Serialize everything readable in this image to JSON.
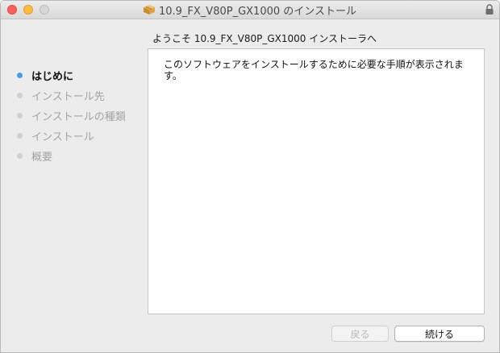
{
  "window": {
    "title": "10.9_FX_V80P_GX1000 のインストール"
  },
  "heading": "ようこそ 10.9_FX_V80P_GX1000 インストーラへ",
  "sidebar": {
    "steps": [
      {
        "label": "はじめに",
        "active": true
      },
      {
        "label": "インストール先",
        "active": false
      },
      {
        "label": "インストールの種類",
        "active": false
      },
      {
        "label": "インストール",
        "active": false
      },
      {
        "label": "概要",
        "active": false
      }
    ]
  },
  "content": {
    "text": "このソフトウェアをインストールするために必要な手順が表示されます。"
  },
  "buttons": {
    "back_label": "戻る",
    "continue_label": "続ける"
  },
  "colors": {
    "active_step_dot": "#4a9ce8",
    "inactive_step_dot": "#d0d0d0",
    "close": "#fc605c",
    "minimize": "#fdbc40"
  }
}
